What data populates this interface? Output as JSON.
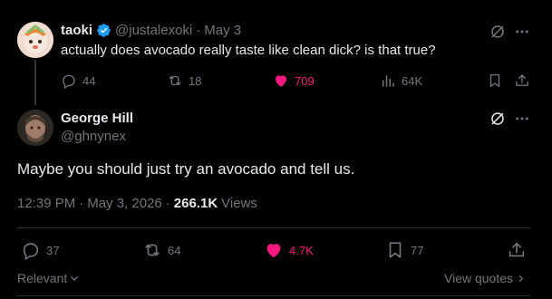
{
  "parent": {
    "display_name": "taoki",
    "handle": "@justalexoki",
    "date": "May 3",
    "separator": "·",
    "text": "actually does avocado really taste like clean dick? is that true?",
    "actions": {
      "replies": "44",
      "reposts": "18",
      "likes": "709",
      "views": "64K"
    }
  },
  "reply": {
    "display_name": "George Hill",
    "handle": "@ghnynex",
    "text": "Maybe you should just try an avocado and tell us.",
    "meta": {
      "time": "12:39 PM",
      "sep1": "·",
      "date": "May 3, 2026",
      "sep2": "·",
      "views_count": "266.1K",
      "views_label": "Views"
    },
    "actions": {
      "replies": "37",
      "reposts": "64",
      "likes": "4.7K",
      "bookmarks": "77"
    }
  },
  "footer": {
    "sort_label": "Relevant",
    "view_quotes_label": "View quotes"
  },
  "colors": {
    "background": "#000000",
    "text": "#e7e9ea",
    "muted": "#71767b",
    "like": "#f91880",
    "verified": "#1d9bf0"
  },
  "icons": {
    "verified": "verified-badge-icon",
    "grok": "grok-icon",
    "more": "more-icon",
    "reply": "reply-icon",
    "repost": "repost-icon",
    "like": "heart-icon",
    "views": "views-chart-icon",
    "bookmark": "bookmark-icon",
    "share": "share-icon",
    "chevron_down": "chevron-down-icon",
    "chevron_right": "chevron-right-icon"
  }
}
